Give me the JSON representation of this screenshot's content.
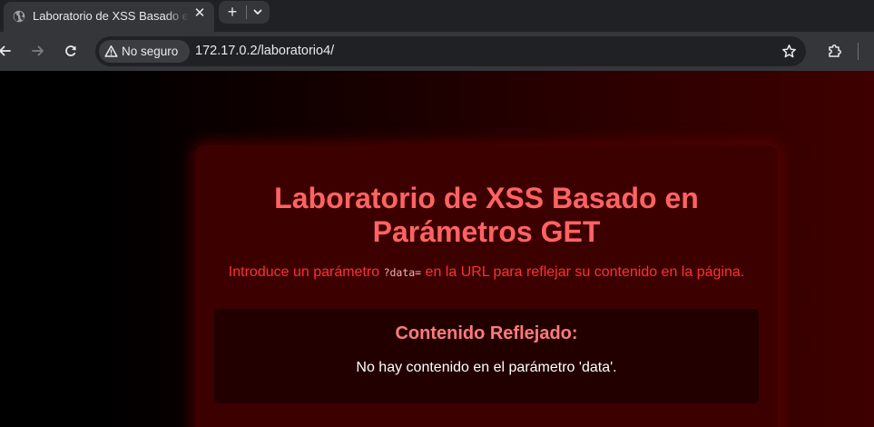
{
  "browser": {
    "tab": {
      "title": "Laboratorio de XSS Basado en Parámetros GET",
      "favicon": "globe-icon",
      "close_icon": "close-icon"
    },
    "new_tab_icon": "plus-icon",
    "tab_list_icon": "chevron-down-icon",
    "nav": {
      "back_icon": "arrow-left-icon",
      "forward_icon": "arrow-right-icon",
      "reload_icon": "reload-icon"
    },
    "omnibox": {
      "security_icon": "warning-triangle-icon",
      "security_label": "No seguro",
      "url": "172.17.0.2/laboratorio4/",
      "bookmark_icon": "star-icon"
    },
    "extensions_icon": "puzzle-icon"
  },
  "page": {
    "title": "Laboratorio de XSS Basado en Parámetros GET",
    "description_before": "Introduce un parámetro ",
    "description_code": "?data=",
    "description_after": " en la URL para reflejar su contenido en la página.",
    "reflected_heading": "Contenido Reflejado:",
    "reflected_content": "No hay contenido en el parámetro 'data'."
  },
  "colors": {
    "chrome_dark": "#202124",
    "chrome_toolbar": "#35363a",
    "card_background": "#3d0000",
    "title_color": "#ff6363",
    "description_color": "#ff3030",
    "reflect_box_background": "#220000",
    "reflect_heading_color": "#ff7b7b",
    "reflect_text_color": "#ffffff"
  }
}
